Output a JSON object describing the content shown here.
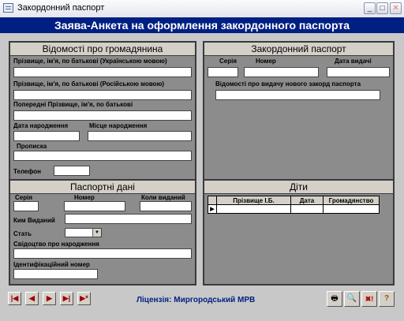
{
  "window": {
    "title": "Закордонний паспорт",
    "min": "_",
    "max": "□",
    "close": "✕"
  },
  "banner": "Заява-Анкета на оформлення закордонного паспорта",
  "citizen": {
    "header": "Відомості про громадянина",
    "name_ua": "Прізвище, ім'я, по батькові (Українською мовою)",
    "name_ru": "Прізвище, ім'я, по батькові (Російською мовою)",
    "name_prev": "Попередні Прізвище, ім'я, по батькові",
    "birth_date": "Дата народження",
    "birth_place": "Місце народження",
    "registration": "Прописка",
    "phone": "Телефон"
  },
  "foreign": {
    "header": "Закордонний паспорт",
    "series": "Серія",
    "number": "Номер",
    "issue_date": "Дата видачі",
    "new_info": "Відомості про видачу нового закорд паспорта"
  },
  "passport": {
    "header": "Паспортні дані",
    "series": "Серія",
    "number": "Номер",
    "issued_when": "Коли виданий",
    "issued_by": "Ким Виданий",
    "sex": "Стать",
    "birth_cert": "Свідоцтво про народження",
    "tax_id": "Ідентифікаційний номер"
  },
  "children": {
    "header": "Діти",
    "columns": [
      "Прізвище І.Б.",
      "Дата",
      "Громадянство"
    ],
    "row_marker": "▶"
  },
  "nav": {
    "first": "|◀",
    "prev": "◀",
    "next": "▶",
    "last": "▶|",
    "new": "▶*"
  },
  "license": "Ліцензія: Миргородський МРВ",
  "tools": {
    "print": "🖶",
    "find": "🔍",
    "delete": "✖!",
    "help": "?"
  }
}
